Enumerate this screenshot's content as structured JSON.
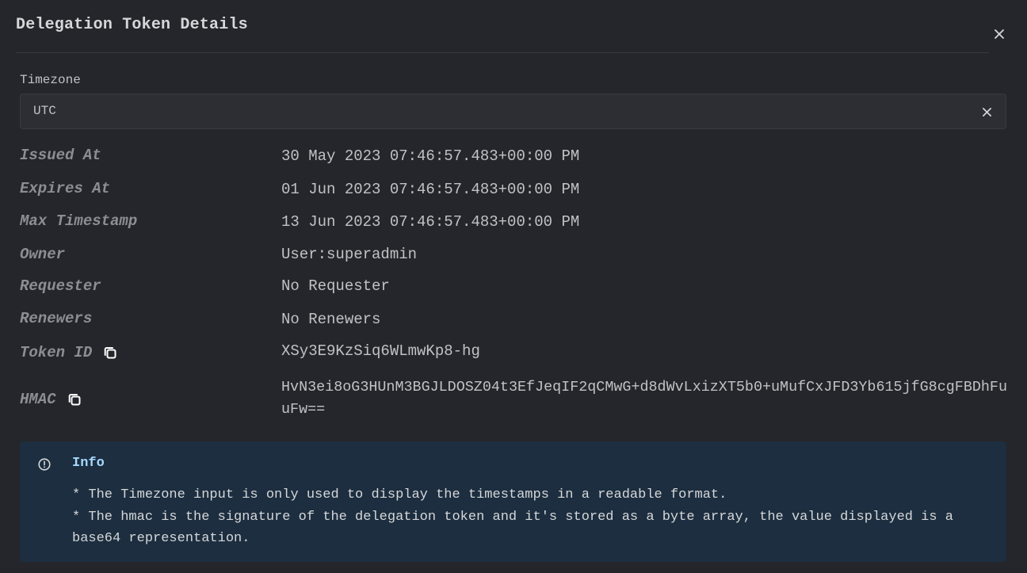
{
  "modal": {
    "title": "Delegation Token Details",
    "close_icon": "close-icon"
  },
  "timezone": {
    "label": "Timezone",
    "value": "UTC",
    "clear_icon": "close-icon"
  },
  "details": {
    "issued_at": {
      "label": "Issued At",
      "value": "30 May 2023 07:46:57.483+00:00 PM"
    },
    "expires_at": {
      "label": "Expires At",
      "value": "01 Jun 2023 07:46:57.483+00:00 PM"
    },
    "max_timestamp": {
      "label": "Max Timestamp",
      "value": "13 Jun 2023 07:46:57.483+00:00 PM"
    },
    "owner": {
      "label": "Owner",
      "value": "User:superadmin"
    },
    "requester": {
      "label": "Requester",
      "value": "No Requester"
    },
    "renewers": {
      "label": "Renewers",
      "value": "No Renewers"
    },
    "token_id": {
      "label": "Token ID",
      "value": "XSy3E9KzSiq6WLmwKp8-hg",
      "icon": "copy-icon"
    },
    "hmac": {
      "label": "HMAC",
      "value": "HvN3ei8oG3HUnM3BGJLDOSZ04t3EfJeqIF2qCMwG+d8dWvLxizXT5b0+uMufCxJFD3Yb615jfG8cgFBDhFuuFw==",
      "icon": "copy-icon"
    }
  },
  "info": {
    "title": "Info",
    "icon": "info-circle-icon",
    "lines": [
      "* The Timezone input is only used to display the timestamps in a readable format.",
      "* The hmac is the signature of the delegation token and it's stored as a byte array, the value displayed is a base64 representation."
    ]
  },
  "colors": {
    "background": "#25262b",
    "input_background": "#2c2e33",
    "info_background": "#1c2e3f",
    "info_title": "#a5d8ff",
    "label": "#8d8e93"
  }
}
